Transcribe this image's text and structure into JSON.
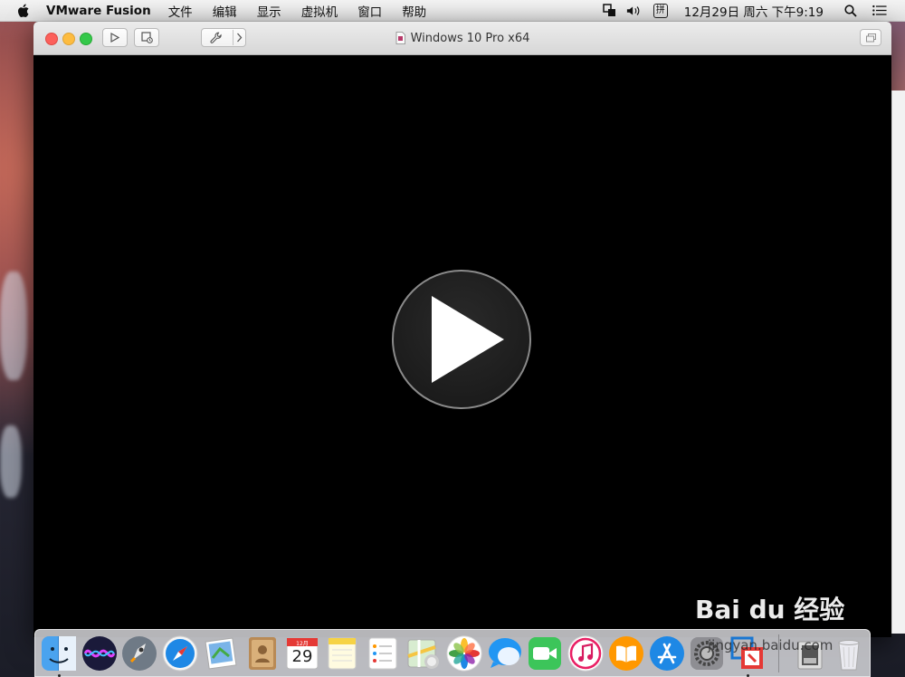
{
  "menubar": {
    "app_name": "VMware Fusion",
    "items": [
      "文件",
      "编辑",
      "显示",
      "虚拟机",
      "窗口",
      "帮助"
    ],
    "ime_label": "拼",
    "clock": "12月29日 周六 下午9:19"
  },
  "window": {
    "title": "Windows 10 Pro x64"
  },
  "dock": {
    "calendar_month": "12月",
    "calendar_day": "29"
  },
  "watermark": {
    "brand": "Bai du 经验",
    "url": "jingyan.baidu.com"
  },
  "colors": {
    "close": "#fc605b",
    "minimize": "#fdbc40",
    "zoom": "#34c84a"
  }
}
